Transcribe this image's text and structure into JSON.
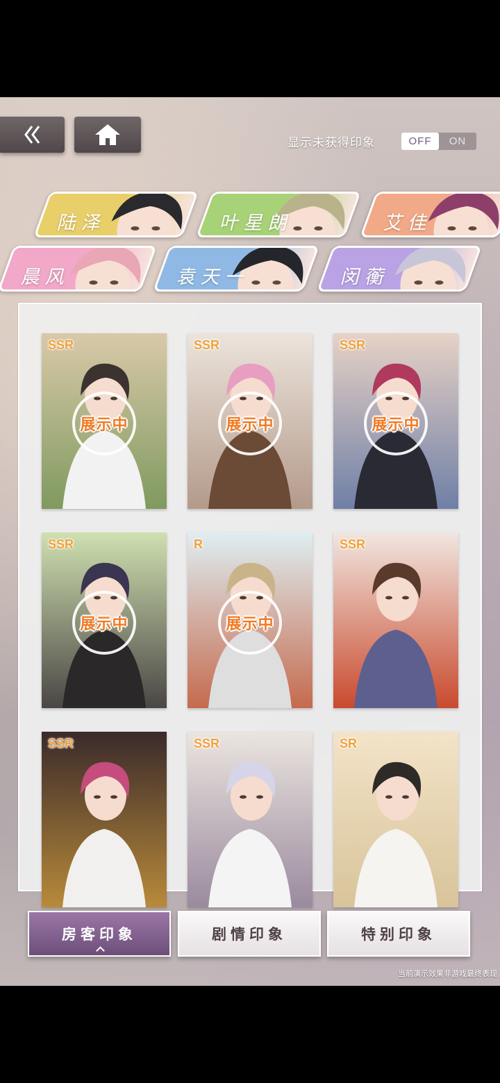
{
  "header": {
    "toggle_label": "显示未获得印象",
    "toggle_off": "OFF",
    "toggle_on": "ON"
  },
  "characters": [
    {
      "name": "陆泽",
      "color": "#e9cf6a",
      "hair": "#2a2a2e",
      "selected": false
    },
    {
      "name": "叶星朗",
      "color": "#a8d277",
      "hair": "#b9b28a",
      "selected": false
    },
    {
      "name": "艾佳",
      "color": "#f2a987",
      "hair": "#8d3f6a",
      "selected": false
    },
    {
      "name": "晨风",
      "color": "#f2a8c8",
      "hair": "#e9a6b4",
      "selected": false
    },
    {
      "name": "袁天一",
      "color": "#8fb9e4",
      "hair": "#25262b",
      "selected": false
    },
    {
      "name": "闵蘅",
      "color": "#b9a3e4",
      "hair": "#c7c6d8",
      "selected": false
    }
  ],
  "cards": [
    {
      "rarity": "SSR",
      "showing": true,
      "bg1": "#d9c9a9",
      "bg2": "#7f9a5f",
      "hair": "#3b3330",
      "cloth": "#f2f2f2"
    },
    {
      "rarity": "SSR",
      "showing": true,
      "bg1": "#ece4dc",
      "bg2": "#b39a8a",
      "hair": "#e79ec0",
      "cloth": "#6b4a36"
    },
    {
      "rarity": "SSR",
      "showing": true,
      "bg1": "#e7d2c6",
      "bg2": "#6f7fa6",
      "hair": "#b0395e",
      "cloth": "#2a2a34"
    },
    {
      "rarity": "SSR",
      "showing": true,
      "bg1": "#cfe0b0",
      "bg2": "#4a4644",
      "hair": "#3a3550",
      "cloth": "#2a2828"
    },
    {
      "rarity": "R",
      "showing": true,
      "bg1": "#dfeef2",
      "bg2": "#c56a4e",
      "hair": "#c9b48a",
      "cloth": "#dedede"
    },
    {
      "rarity": "SSR",
      "showing": false,
      "bg1": "#f0e6e0",
      "bg2": "#c94a2e",
      "hair": "#5a3a2a",
      "cloth": "#5d5f8f"
    },
    {
      "rarity": "SSR",
      "showing": false,
      "bg1": "#3a2a2a",
      "bg2": "#b88a3a",
      "hair": "#c44d7e",
      "cloth": "#f2f0ee"
    },
    {
      "rarity": "SSR",
      "showing": false,
      "bg1": "#ebe5df",
      "bg2": "#9a8a9e",
      "hair": "#d6d4e8",
      "cloth": "#f4f4f4"
    },
    {
      "rarity": "SR",
      "showing": false,
      "bg1": "#f3e3c8",
      "bg2": "#d8c49a",
      "hair": "#2e2a28",
      "cloth": "#f6f4f0"
    }
  ],
  "showing_label": "展示中",
  "bottom_tabs": [
    {
      "label": "房客印象",
      "active": true
    },
    {
      "label": "剧情印象",
      "active": false
    },
    {
      "label": "特别印象",
      "active": false
    }
  ],
  "footnote": "当前演示效果非游戏最终表现"
}
